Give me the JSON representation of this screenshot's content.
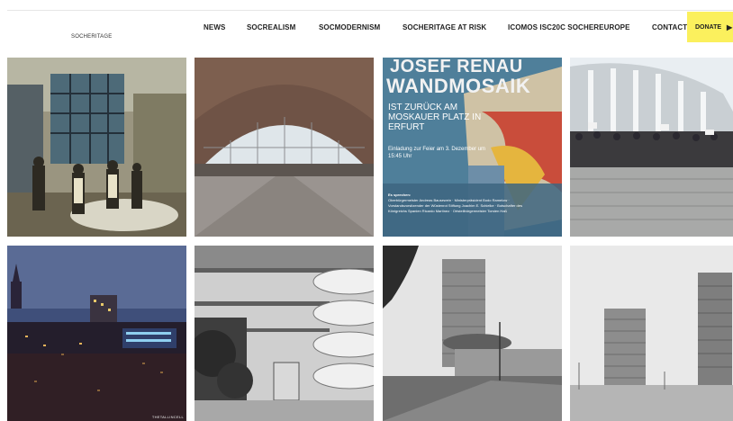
{
  "site": {
    "logo_text": "SOCHERITAGE"
  },
  "nav": {
    "items": [
      {
        "label": "NEWS"
      },
      {
        "label": "SOCREALISM"
      },
      {
        "label": "SOCMODERNISM"
      },
      {
        "label": "SOCHERITAGE AT RISK"
      },
      {
        "label": "ICOMOS ISC20C SOCHEREUROPE"
      },
      {
        "label": "CONTACT"
      }
    ],
    "donate_label": "DONATE"
  },
  "poster": {
    "title_line1": "JOSEF RENAU",
    "title_line2": "WANDMOSAIK",
    "subtitle": "IST ZURÜCK AM MOSKAUER PLATZ IN ERFURT",
    "invitation": "Einladung zur Feier am 3. Dezember um 15:45 Uhr",
    "speakers_heading": "Es sprechen:",
    "speakers_text": "Oberbürgermeister Andreas Bausewein · Ministerpräsident Bodo Ramelow · Vorstandsvorsitzender der Wüstenrot Stiftung Joachim E. Schielke · Botschafter des Königreichs Spanien Ricardo Martínez · Ortsteilbürgermeister Torsten Haß"
  },
  "tiles": {
    "credit_5": "THETALLINCELL"
  },
  "colors": {
    "accent": "#fbf05d",
    "nav_text": "#222222"
  }
}
